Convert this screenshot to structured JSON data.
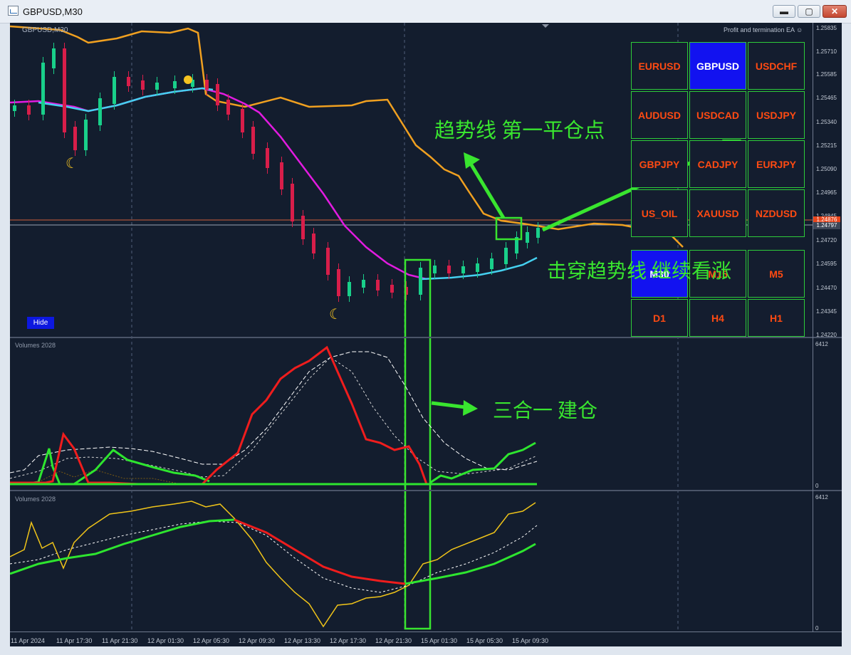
{
  "window": {
    "title": "GBPUSD,M30",
    "controls": {
      "minimize": "▬",
      "maximize": "▢",
      "close": "✕"
    }
  },
  "chart": {
    "symbol_label": "GBPUSD,M30",
    "ea_label": "Profit and termination EA ☺",
    "price_axis": [
      "1.25835",
      "1.25710",
      "1.25585",
      "1.25465",
      "1.25340",
      "1.25215",
      "1.25090",
      "1.24965",
      "1.24845",
      "1.24720",
      "1.24595",
      "1.24470",
      "1.24345",
      "1.24220"
    ],
    "price_tags": {
      "ask": "1.24876",
      "bid": "1.24797",
      "ask_color": "#e8451c",
      "bid_color": "#3d4657"
    },
    "hide_button": "Hide",
    "volumes1": {
      "label": "Volumes 2028",
      "max": "6412",
      "min": "0"
    },
    "volumes2": {
      "label": "Volumes 2028",
      "max": "6412",
      "min": "0"
    },
    "time_axis": [
      "11 Apr 2024",
      "11 Apr 17:30",
      "11 Apr 21:30",
      "12 Apr 01:30",
      "12 Apr 05:30",
      "12 Apr 09:30",
      "12 Apr 13:30",
      "12 Apr 17:30",
      "12 Apr 21:30",
      "15 Apr 01:30",
      "15 Apr 05:30",
      "15 Apr 09:30"
    ]
  },
  "panel": {
    "symbols": [
      {
        "label": "EURUSD",
        "active": false
      },
      {
        "label": "GBPUSD",
        "active": true
      },
      {
        "label": "USDCHF",
        "active": false
      },
      {
        "label": "AUDUSD",
        "active": false
      },
      {
        "label": "USDCAD",
        "active": false
      },
      {
        "label": "USDJPY",
        "active": false
      },
      {
        "label": "GBPJPY",
        "active": false
      },
      {
        "label": "CADJPY",
        "active": false
      },
      {
        "label": "EURJPY",
        "active": false
      },
      {
        "label": "US_OIL",
        "active": false
      },
      {
        "label": "XAUUSD",
        "active": false
      },
      {
        "label": "NZDUSD",
        "active": false
      }
    ],
    "timeframes": [
      {
        "label": "M30",
        "active": true
      },
      {
        "label": "M15",
        "active": false
      },
      {
        "label": "M5",
        "active": false
      },
      {
        "label": "D1",
        "active": false
      },
      {
        "label": "H4",
        "active": false
      },
      {
        "label": "H1",
        "active": false
      }
    ]
  },
  "annotations": {
    "first_close": "趋势线 第一平仓点",
    "breakout": "击穿趋势线 继续看涨",
    "triple": "三合一 建仓"
  },
  "colors": {
    "background": "#131d2e",
    "bull": "#19d08a",
    "bear": "#d81e4a",
    "accent_green": "#39e52f"
  }
}
